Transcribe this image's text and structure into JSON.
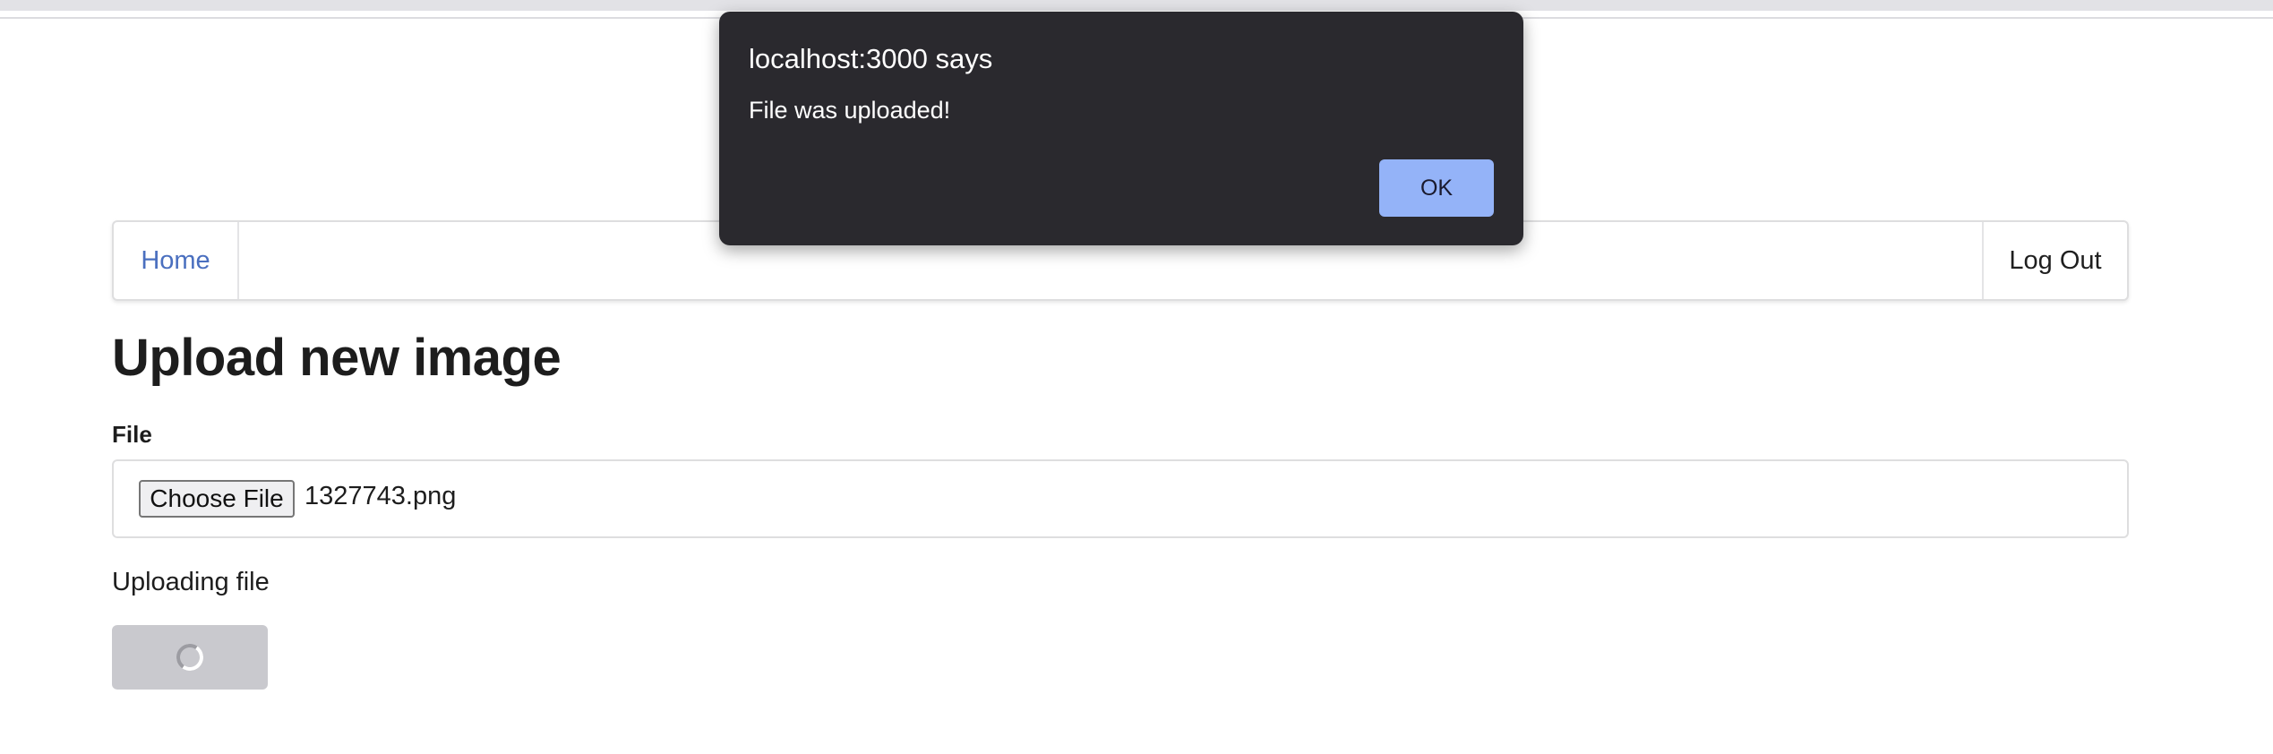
{
  "navbar": {
    "home_label": "Home",
    "logout_label": "Log Out"
  },
  "main": {
    "title": "Upload new image",
    "file_label": "File",
    "choose_file_label": "Choose File",
    "selected_file": "1327743.png",
    "status_text": "Uploading file"
  },
  "alert": {
    "title": "localhost:3000 says",
    "message": "File was uploaded!",
    "ok_label": "OK"
  },
  "colors": {
    "link": "#4a6fbf",
    "alert_background": "#2a292e",
    "alert_ok_button": "#94b3f8",
    "submit_disabled": "#c9c9ce"
  },
  "icons": {
    "loading": "spinner-icon"
  }
}
